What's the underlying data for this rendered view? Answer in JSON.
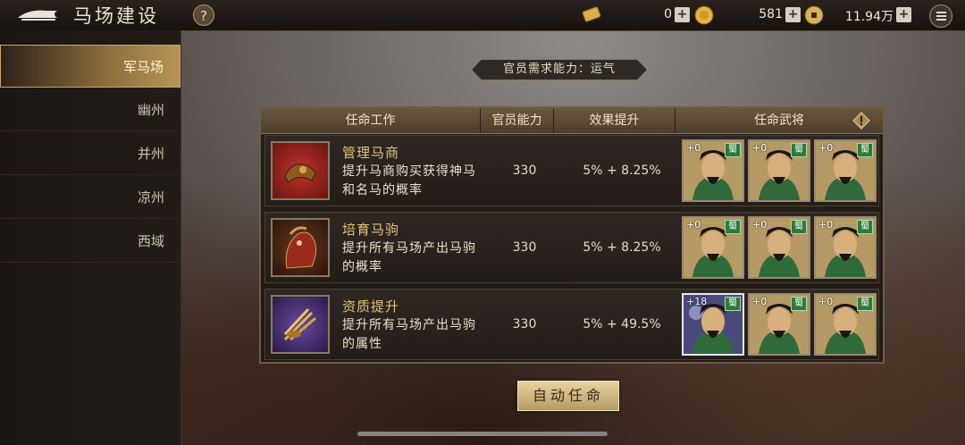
{
  "header": {
    "title": "马场建设",
    "help_label": "?",
    "resources": [
      {
        "icon": "scroll-token-icon",
        "value": "0"
      },
      {
        "icon": "gold-ingot-icon",
        "value": "581"
      },
      {
        "icon": "copper-coin-icon",
        "value": "11.94万"
      }
    ],
    "plus_label": "+"
  },
  "sidebar": {
    "items": [
      {
        "label": "军马场",
        "active": true
      },
      {
        "label": "幽州"
      },
      {
        "label": "并州"
      },
      {
        "label": "凉州"
      },
      {
        "label": "西域"
      }
    ]
  },
  "requirement": "官员需求能力：运气",
  "table": {
    "headers": [
      "任命工作",
      "官员能力",
      "效果提升",
      "任命武将"
    ],
    "rows": [
      {
        "icon": "saddle-icon",
        "name": "管理马商",
        "desc": "提升马商购买获得神马和名马的概率",
        "ability": "330",
        "effect": "5% + 8.25%",
        "generals": [
          {
            "level": "+0",
            "faction": "蜀"
          },
          {
            "level": "+0",
            "faction": "蜀"
          },
          {
            "level": "+0",
            "faction": "蜀"
          }
        ]
      },
      {
        "icon": "red-horse-icon",
        "name": "培育马驹",
        "desc": "提升所有马场产出马驹的概率",
        "ability": "330",
        "effect": "5% + 8.25%",
        "generals": [
          {
            "level": "+0",
            "faction": "蜀"
          },
          {
            "level": "+0",
            "faction": "蜀"
          },
          {
            "level": "+0",
            "faction": "蜀"
          }
        ]
      },
      {
        "icon": "wheat-bundle-icon",
        "name": "资质提升",
        "desc": "提升所有马场产出马驹的属性",
        "ability": "330",
        "effect": "5% + 49.5%",
        "generals": [
          {
            "level": "+18",
            "faction": "蜀"
          },
          {
            "level": "+0",
            "faction": "蜀"
          },
          {
            "level": "+0",
            "faction": "蜀"
          }
        ]
      }
    ]
  },
  "auto_button": "自动任命",
  "colors": {
    "accent_gold": "#b89556",
    "faction_green": "#2e7a3a"
  }
}
